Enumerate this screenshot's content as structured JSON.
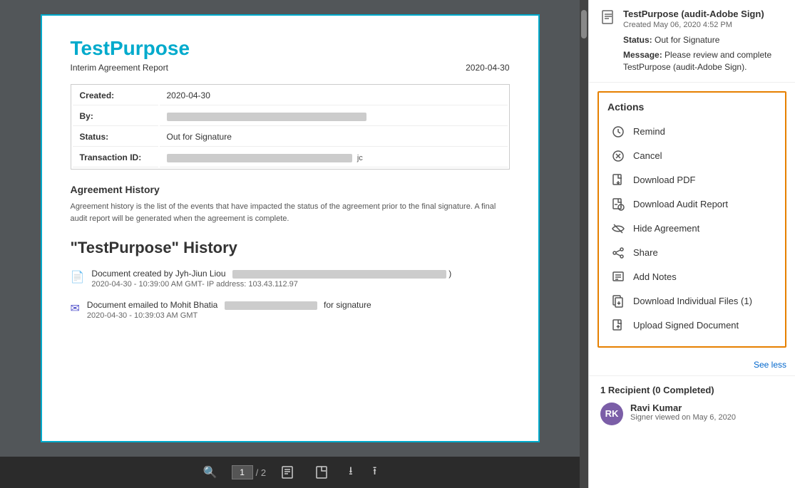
{
  "docViewer": {
    "title": "TestPurpose",
    "subtitle": "Interim Agreement Report",
    "date": "2020-04-30",
    "infoTable": {
      "created_label": "Created:",
      "created_value": "2020-04-30",
      "by_label": "By:",
      "status_label": "Status:",
      "status_value": "Out for Signature",
      "transaction_label": "Transaction ID:"
    },
    "agreementHistoryTitle": "Agreement History",
    "agreementHistoryText": "Agreement history is the list of the events that have impacted the status of the agreement prior to the final signature. A final audit report will be generated when the agreement is complete.",
    "historyTitle": "\"TestPurpose\" History",
    "historyItems": [
      {
        "icon": "doc",
        "text": "Document created by Jyh-Jiun Liou",
        "date": "2020-04-30 - 10:39:00 AM GMT- IP address: 103.43.112.97"
      },
      {
        "icon": "email",
        "text": "Document emailed to Mohit Bhatia",
        "suffix": "for signature",
        "date": "2020-04-30 - 10:39:03 AM GMT"
      }
    ],
    "toolbar": {
      "page_current": "1",
      "page_total": "2"
    }
  },
  "rightPanel": {
    "header": {
      "title": "TestPurpose (audit-Adobe Sign)",
      "date": "Created May 06, 2020 4:52 PM",
      "status_label": "Status:",
      "status_value": "Out for Signature",
      "message_label": "Message:",
      "message_value": "Please review and complete TestPurpose (audit-Adobe Sign)."
    },
    "actions": {
      "title": "Actions",
      "items": [
        {
          "icon": "remind",
          "label": "Remind"
        },
        {
          "icon": "cancel",
          "label": "Cancel"
        },
        {
          "icon": "download-pdf",
          "label": "Download PDF"
        },
        {
          "icon": "download-audit",
          "label": "Download Audit Report"
        },
        {
          "icon": "hide",
          "label": "Hide Agreement"
        },
        {
          "icon": "share",
          "label": "Share"
        },
        {
          "icon": "notes",
          "label": "Add Notes"
        },
        {
          "icon": "download-files",
          "label": "Download Individual Files (1)"
        },
        {
          "icon": "upload",
          "label": "Upload Signed Document"
        }
      ],
      "see_less": "See less"
    },
    "recipients": {
      "title": "1 Recipient (0 Completed)",
      "list": [
        {
          "name": "Ravi Kumar",
          "initials": "RK",
          "status": "Signer viewed on May 6, 2020"
        }
      ]
    }
  }
}
